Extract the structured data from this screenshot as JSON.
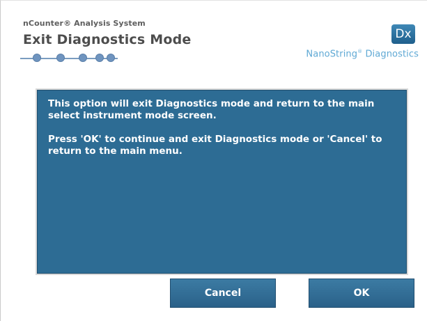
{
  "header": {
    "app_name": "nCounter® Analysis System",
    "title": "Exit Diagnostics Mode",
    "progress_step_count": 5,
    "logo_text": "Dx",
    "brand_text": "NanoString",
    "brand_text_suffix": " Diagnostics",
    "brand_mark": "®"
  },
  "message": {
    "paragraph1": "This option will exit Diagnostics mode and return to the main select instrument mode screen.",
    "paragraph2": "Press 'OK' to continue and exit Diagnostics mode or 'Cancel' to return to the main menu."
  },
  "buttons": {
    "cancel_label": "Cancel",
    "ok_label": "OK"
  },
  "colors": {
    "panel": "#2d6c94",
    "accent": "#5ea8d4",
    "button": "#3c7ba3"
  }
}
